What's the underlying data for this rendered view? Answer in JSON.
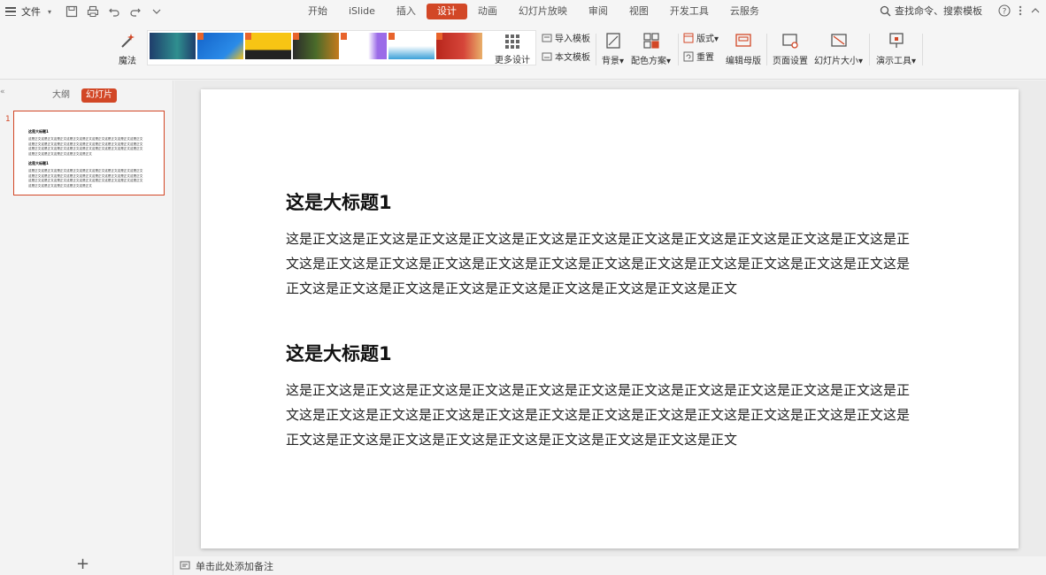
{
  "menubar": {
    "file_label": "文件",
    "tabs": [
      {
        "label": "开始"
      },
      {
        "label": "iSlide"
      },
      {
        "label": "插入"
      },
      {
        "label": "设计"
      },
      {
        "label": "动画"
      },
      {
        "label": "幻灯片放映"
      },
      {
        "label": "审阅"
      },
      {
        "label": "视图"
      },
      {
        "label": "开发工具"
      },
      {
        "label": "云服务"
      }
    ],
    "active_tab": "设计",
    "search_text": "查找命令、搜索模板"
  },
  "ribbon": {
    "magic_label": "魔法",
    "more_design_label": "更多设计",
    "import_template_label": "导入模板",
    "this_template_label": "本文模板",
    "background_label": "背景",
    "color_scheme_label": "配色方案",
    "layout_label": "版式",
    "reset_label": "重置",
    "edit_master_label": "编辑母版",
    "page_setup_label": "页面设置",
    "slide_size_label": "幻灯片大小",
    "presentation_tools_label": "演示工具"
  },
  "left_panel": {
    "outline_tab": "大纲",
    "slides_tab": "幻灯片",
    "slide_number": "1",
    "add_label": "+"
  },
  "slide": {
    "sections": [
      {
        "title": "这是大标题1",
        "body": "这是正文这是正文这是正文这是正文这是正文这是正文这是正文这是正文这是正文这是正文这是正文这是正文这是正文这是正文这是正文这是正文这是正文这是正文这是正文这是正文这是正文这是正文这是正文这是正文这是正文这是正文这是正文这是正文这是正文这是正文这是正文这是正文"
      },
      {
        "title": "这是大标题1",
        "body": "这是正文这是正文这是正文这是正文这是正文这是正文这是正文这是正文这是正文这是正文这是正文这是正文这是正文这是正文这是正文这是正文这是正文这是正文这是正文这是正文这是正文这是正文这是正文这是正文这是正文这是正文这是正文这是正文这是正文这是正文这是正文这是正文"
      }
    ]
  },
  "notes": {
    "placeholder": "单击此处添加备注"
  },
  "colors": {
    "accent": "#d24726"
  }
}
